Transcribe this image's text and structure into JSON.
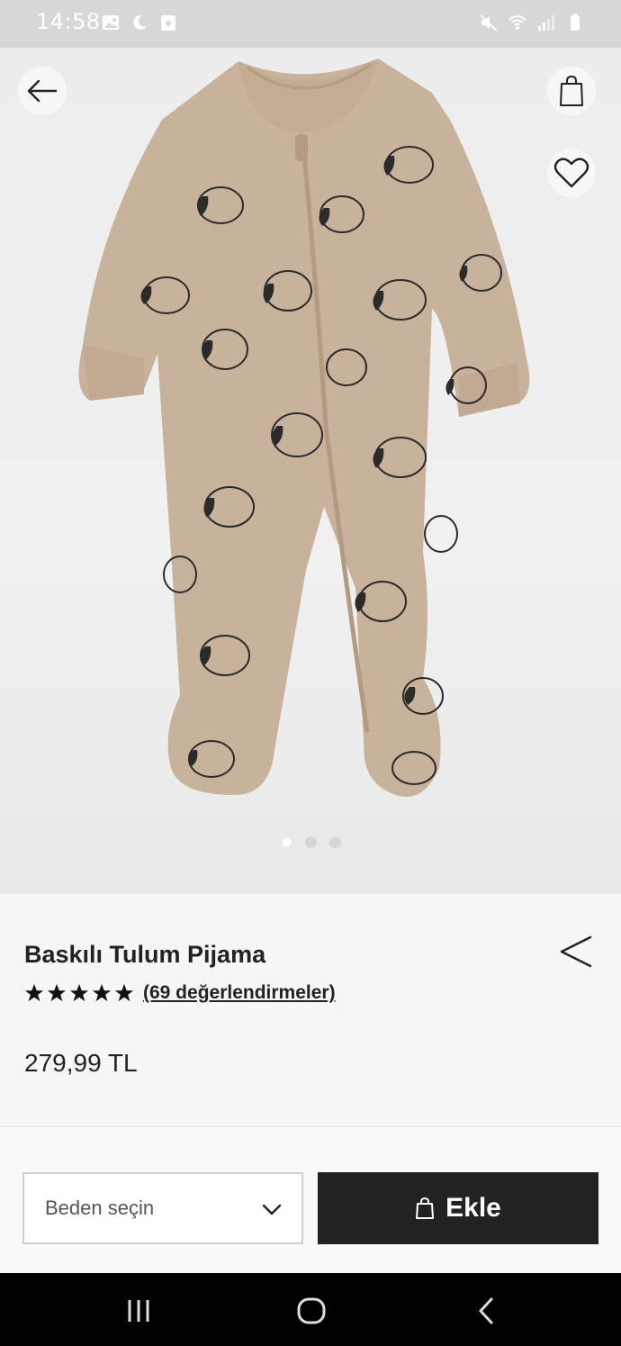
{
  "status_bar": {
    "time": "14:58",
    "left_icons": [
      "gallery-icon",
      "moon-icon",
      "calendar-icon"
    ],
    "right_icons": [
      "mute-icon",
      "wifi-icon",
      "signal-icon",
      "battery-icon"
    ]
  },
  "product_image": {
    "dots": [
      true,
      false,
      false
    ]
  },
  "header_actions": {
    "back_icon": "arrow-left-icon",
    "bag_icon": "shopping-bag-icon",
    "favorite_icon": "heart-icon"
  },
  "product": {
    "title": "Baskılı Tulum Pijama",
    "rating_stars": 5,
    "reviews_text": "(69 değerlendirmeler)",
    "price": "279,99 TL"
  },
  "actions": {
    "size_placeholder": "Beden seçin",
    "add_label": "Ekle"
  },
  "colors": {
    "primary_button": "#222222",
    "garment": "#c9b19a",
    "print": "#2a2a2a"
  }
}
